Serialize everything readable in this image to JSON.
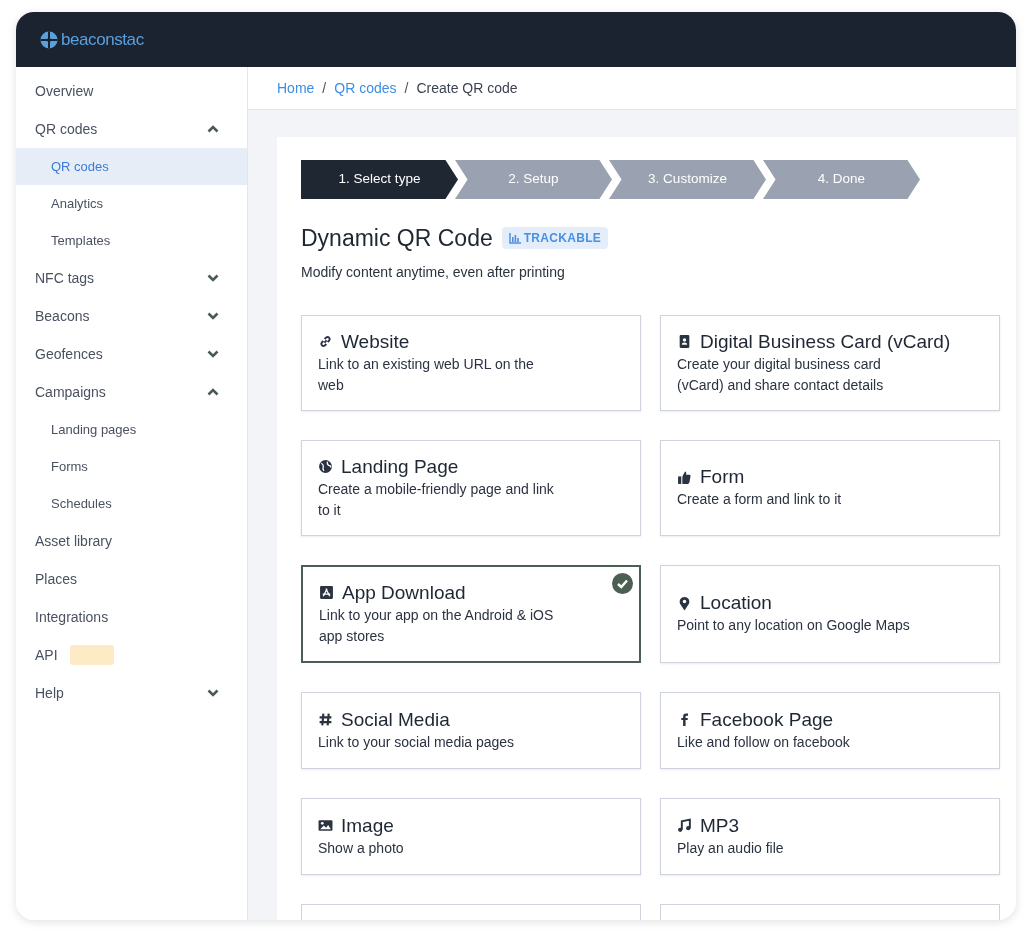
{
  "brand": {
    "name": "beaconstac"
  },
  "sidebar": {
    "items": [
      {
        "label": "Overview"
      },
      {
        "label": "QR codes",
        "expanded": true,
        "children": [
          {
            "label": "QR codes",
            "selected": true
          },
          {
            "label": "Analytics",
            "selected": false
          },
          {
            "label": "Templates",
            "selected": false
          }
        ]
      },
      {
        "label": "NFC tags",
        "expanded": false
      },
      {
        "label": "Beacons",
        "expanded": false
      },
      {
        "label": "Geofences",
        "expanded": false
      },
      {
        "label": "Campaigns",
        "expanded": true,
        "children": [
          {
            "label": "Landing pages",
            "selected": false
          },
          {
            "label": "Forms",
            "selected": false
          },
          {
            "label": "Schedules",
            "selected": false
          }
        ]
      },
      {
        "label": "Asset library"
      },
      {
        "label": "Places"
      },
      {
        "label": "Integrations"
      },
      {
        "label": "API",
        "badge": true
      },
      {
        "label": "Help",
        "expanded": false
      }
    ]
  },
  "breadcrumb_separator": "/",
  "breadcrumb": [
    {
      "label": "Home",
      "link": true
    },
    {
      "label": "QR codes",
      "link": true
    },
    {
      "label": "Create QR code",
      "link": false
    }
  ],
  "steps": [
    {
      "label": "1. Select type",
      "selected": true
    },
    {
      "label": "2. Setup",
      "selected": false
    },
    {
      "label": "3. Customize",
      "selected": false
    },
    {
      "label": "4. Done",
      "selected": false
    }
  ],
  "heading": {
    "title": "Dynamic QR Code",
    "badge": "TRACKABLE",
    "subtitle": "Modify content anytime, even after printing"
  },
  "cards": [
    {
      "kind": "type",
      "title": "Website",
      "description": "Link to an existing web URL on the web",
      "selected": false
    },
    {
      "kind": "type",
      "title": "Digital Business Card (vCard)",
      "description": "Create your digital business card (vCard) and share contact details",
      "selected": false
    },
    {
      "kind": "type",
      "title": "Landing Page",
      "description": "Create a mobile-friendly page and link to it",
      "selected": false
    },
    {
      "kind": "type",
      "title": "Form",
      "description": "Create a form and link to it",
      "selected": false
    },
    {
      "kind": "type",
      "title": "App Download",
      "description": "Link to your app on the Android & iOS app stores",
      "selected": true
    },
    {
      "kind": "type",
      "title": "Location",
      "description": "Point to any location on Google Maps",
      "selected": false
    },
    {
      "kind": "type",
      "title": "Social Media",
      "description": "Link to your social media pages",
      "selected": false
    },
    {
      "kind": "type",
      "title": "Facebook Page",
      "description": "Like and follow on facebook",
      "selected": false
    },
    {
      "kind": "type",
      "title": "Image",
      "description": "Show a photo",
      "selected": false
    },
    {
      "kind": "type",
      "title": "MP3",
      "description": "Play an audio file",
      "selected": false
    },
    {
      "kind": "cut"
    },
    {
      "kind": "cut"
    }
  ]
}
